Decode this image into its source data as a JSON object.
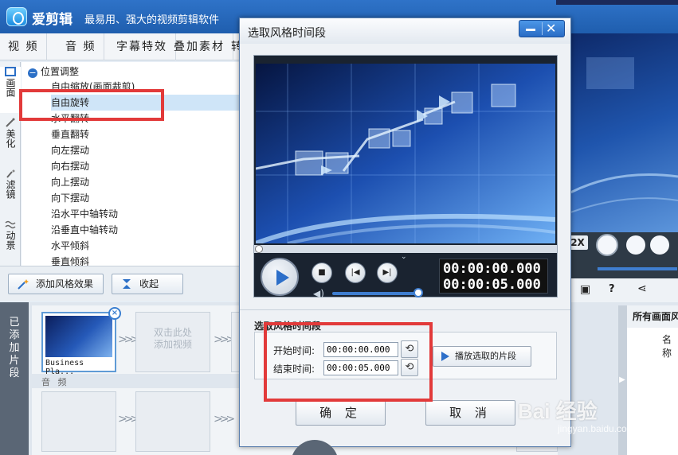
{
  "app": {
    "name": "爱剪辑",
    "slogan": "最易用、强大的视频剪辑软件"
  },
  "nav": {
    "tabs": [
      "视 频",
      "音 频",
      "字幕特效",
      "叠加素材",
      "转"
    ]
  },
  "side_tabs": [
    {
      "label": "画面",
      "icon": "frame-icon"
    },
    {
      "label": "美化",
      "icon": "wand-icon"
    },
    {
      "label": "滤镜",
      "icon": "sparkle-icon"
    },
    {
      "label": "动景",
      "icon": "waves-icon"
    }
  ],
  "effects": {
    "group": "位置调整",
    "items": [
      "自由缩放(画面裁剪)",
      "自由旋转",
      "水平翻转",
      "垂直翻转",
      "向左摆动",
      "向右摆动",
      "向上摆动",
      "向下摆动",
      "沿水平中轴转动",
      "沿垂直中轴转动",
      "水平倾斜",
      "垂直倾斜"
    ],
    "selected_index": 1
  },
  "effect_buttons": {
    "add": "添加风格效果",
    "collapse": "收起"
  },
  "timeline": {
    "tab_label": [
      "已",
      "添",
      "加",
      "片",
      "段"
    ],
    "clip_name": "Business Pla...",
    "placeholder_line1": "双击此处",
    "placeholder_line2": "添加视频",
    "audio_label": "音 频"
  },
  "right_panel": {
    "speed": "2X",
    "list_header": "所有画面风",
    "list_column": "名称"
  },
  "dialog": {
    "title": "选取风格时间段",
    "time_display_start": "00:00:00.000",
    "time_display_end": "00:00:05.000",
    "section_title": "选取风格时间段",
    "start_label": "开始时间:",
    "start_value": "00:00:00.000",
    "end_label": "结束时间:",
    "end_value": "00:00:05.000",
    "play_range_label": "播放选取的片段",
    "ok_label": "确 定",
    "cancel_label": "取 消"
  },
  "watermark": {
    "text": "Bai 经验",
    "sub": "jingyan.baidu.com"
  },
  "colors": {
    "titlebar": "#2a69bd",
    "highlight_box": "#e23a3a",
    "accent": "#2d6fc9"
  }
}
